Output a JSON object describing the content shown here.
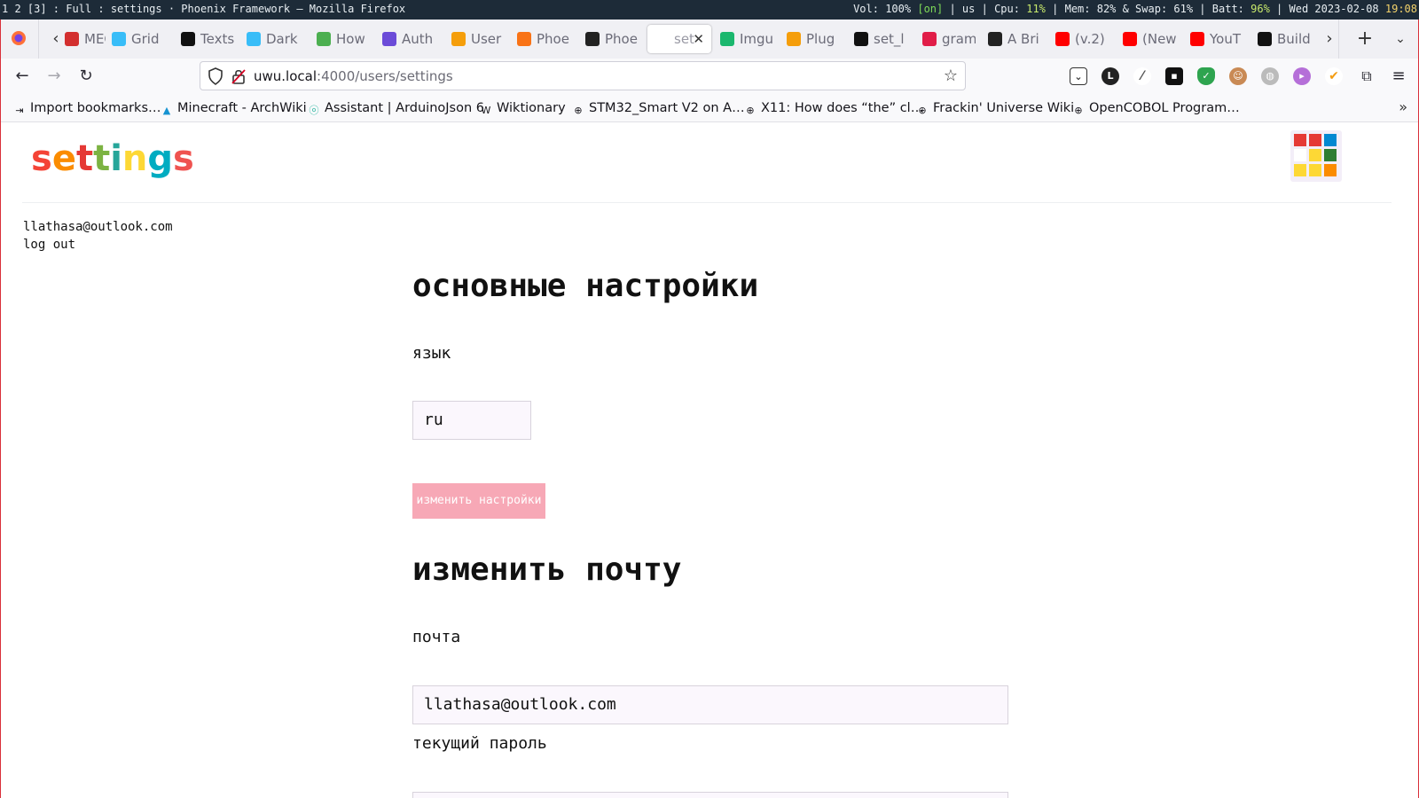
{
  "statusbar": {
    "left": "1 2 [3] : Full : settings · Phoenix Framework — Mozilla Firefox",
    "vol": "Vol: 100%",
    "vol_state": "[on]",
    "layout": "| us |",
    "cpu_label": "Cpu:",
    "cpu": "11%",
    "mem": "| Mem: 82% & Swap: 61% |",
    "batt_label": "Batt:",
    "batt": "96%",
    "date": "| Wed 2023-02-08",
    "time": "19:08"
  },
  "tabs": [
    {
      "label": "MEG",
      "icon": "mega-icon",
      "color": "#d32f2f"
    },
    {
      "label": "Grid",
      "icon": "tailwind-icon",
      "color": "#38bdf8"
    },
    {
      "label": "Texts",
      "icon": "medium-icon",
      "color": "#111111"
    },
    {
      "label": "Dark",
      "icon": "tailwind-icon",
      "color": "#38bdf8"
    },
    {
      "label": "How",
      "icon": "leaf-icon",
      "color": "#4caf50"
    },
    {
      "label": "Auth",
      "icon": "auth-icon",
      "color": "#6b4bd8"
    },
    {
      "label": "User",
      "icon": "flame-icon",
      "color": "#f59e0b"
    },
    {
      "label": "Phoe",
      "icon": "phoenix-icon",
      "color": "#f97316"
    },
    {
      "label": "Phoe",
      "icon": "phoenix-bird-icon",
      "color": "#222222"
    },
    {
      "label": "set",
      "icon": "none",
      "color": "#ffffff"
    },
    {
      "label": "Imgu",
      "icon": "imgur-icon",
      "color": "#1bb76e"
    },
    {
      "label": "Plug",
      "icon": "plug-icon",
      "color": "#f59e0b"
    },
    {
      "label": "set_l",
      "icon": "github-icon",
      "color": "#111111"
    },
    {
      "label": "gram",
      "icon": "gram-icon",
      "color": "#e11d48"
    },
    {
      "label": "A Bri",
      "icon": "phoenix-bird-icon",
      "color": "#222222"
    },
    {
      "label": "(v.2)",
      "icon": "youtube-icon",
      "color": "#ff0000"
    },
    {
      "label": "(New",
      "icon": "youtube-icon",
      "color": "#ff0000"
    },
    {
      "label": "YouT",
      "icon": "youtube-icon",
      "color": "#ff0000"
    },
    {
      "label": "Build",
      "icon": "build-icon",
      "color": "#111111"
    }
  ],
  "url": {
    "host": "uwu.local",
    "path": ":4000/users/settings"
  },
  "bookmarks": [
    {
      "label": "Import bookmarks…",
      "icon": "import-icon"
    },
    {
      "label": "Minecraft - ArchWiki",
      "icon": "arch-icon"
    },
    {
      "label": "Assistant | ArduinoJson 6",
      "icon": "arduinojson-icon"
    },
    {
      "label": "Wiktionary",
      "icon": "wiktionary-icon"
    },
    {
      "label": "STM32_Smart V2 on A…",
      "icon": "globe-icon"
    },
    {
      "label": "X11: How does “the” cl…",
      "icon": "globe-icon"
    },
    {
      "label": "Frackin' Universe Wiki",
      "icon": "globe-icon"
    },
    {
      "label": "OpenCOBOL Program…",
      "icon": "globe-icon"
    }
  ],
  "page": {
    "logo_letters": [
      {
        "ch": "s",
        "color": "#f44336"
      },
      {
        "ch": "e",
        "color": "#fb8c00"
      },
      {
        "ch": "t",
        "color": "#e53935"
      },
      {
        "ch": "t",
        "color": "#7cb342"
      },
      {
        "ch": "i",
        "color": "#26a69a"
      },
      {
        "ch": "n",
        "color": "#fdd835"
      },
      {
        "ch": "g",
        "color": "#00acc1"
      },
      {
        "ch": "s",
        "color": "#ef5350"
      }
    ],
    "user_email": "llathasa@outlook.com",
    "logout": "log out",
    "basic_settings_title": "основные настройки",
    "language_label": "язык",
    "language_value": "ru",
    "change_settings_button": "изменить настройки",
    "change_email_title": "изменить почту",
    "email_label": "почта",
    "email_value": "llathasa@outlook.com",
    "current_password_label": "текущий пароль",
    "current_password_value": ""
  },
  "colors": {
    "accent": "#f7a8b6",
    "frame": "#d9303a",
    "grid_cells": [
      "#e53935",
      "#e53935",
      "#0288d1",
      "#ffffff",
      "#fdd835",
      "#2e7d32",
      "#fdd835",
      "#fdd835",
      "#fb8c00"
    ]
  }
}
